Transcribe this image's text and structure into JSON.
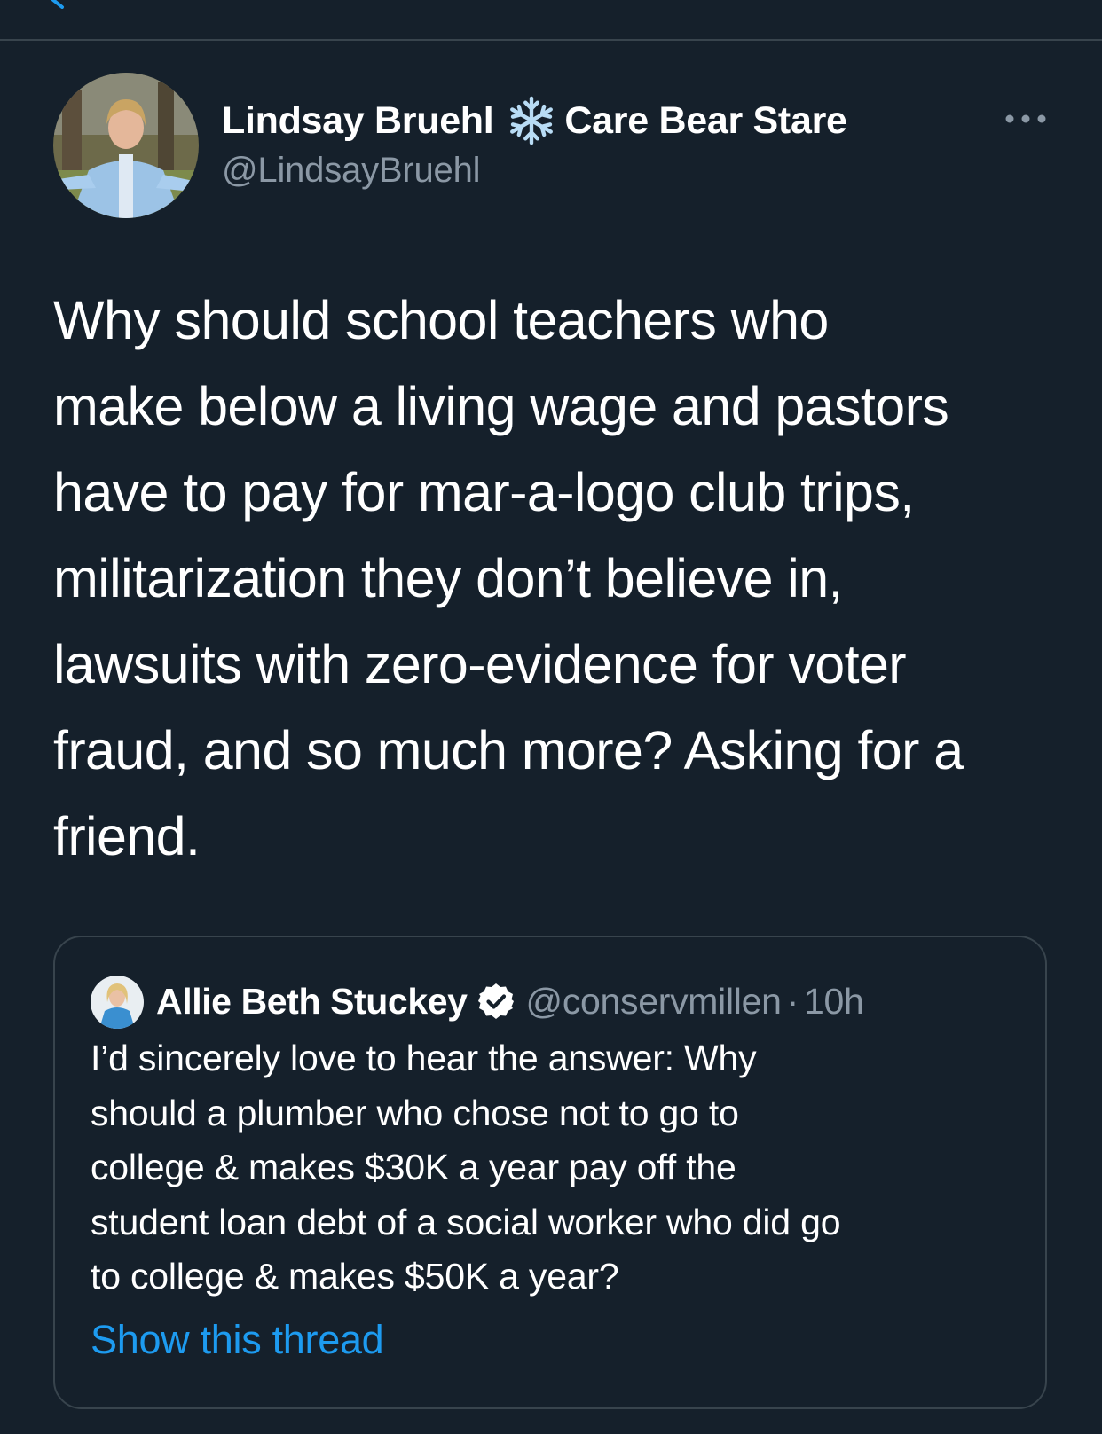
{
  "colors": {
    "background": "#15202b",
    "divider": "#38444d",
    "primary_text": "#ffffff",
    "secondary_text": "#8b98a5",
    "link": "#1d9bf0"
  },
  "tweet": {
    "author": {
      "display_name": "Lindsay Bruehl",
      "name_emoji_icon": "snowflake-icon",
      "name_suffix": "Care Bear Stare",
      "handle": "@LindsayBruehl",
      "avatar_icon": "profile-photo-avatar"
    },
    "menu_icon": "more-options-icon",
    "text": "Why should school teachers who\nmake below a living wage and pastors\nhave to pay for mar-a-logo club trips,\nmilitarization they don’t believe in,\nlawsuits with zero-evidence for voter\nfraud, and so much more? Asking for a\nfriend."
  },
  "quoted_tweet": {
    "author": {
      "display_name": "Allie Beth Stuckey",
      "verified_icon": "verified-badge-icon",
      "handle": "@conservmillen",
      "separator": "·",
      "time": "10h",
      "avatar_icon": "profile-photo-avatar"
    },
    "text": "I’d sincerely love to hear the answer: Why\nshould a plumber who chose not to go to\ncollege & makes $30K a year pay off the\nstudent loan debt of a social worker who did go\nto college & makes $50K a year?",
    "show_thread_label": "Show this thread"
  }
}
